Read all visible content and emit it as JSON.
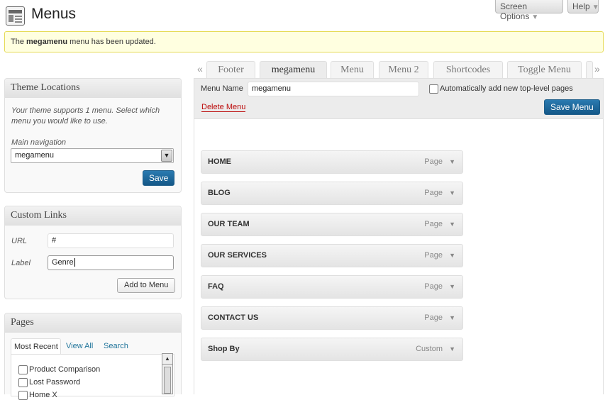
{
  "header": {
    "title": "Menus",
    "screen_options": "Screen Options",
    "help": "Help"
  },
  "notice": {
    "prefix": "The ",
    "menu_name": "megamenu",
    "suffix": " menu has been updated."
  },
  "theme_locations": {
    "title": "Theme Locations",
    "description": "Your theme supports 1 menu. Select which menu you would like to use.",
    "location_label": "Main navigation",
    "selected": "megamenu",
    "save_label": "Save"
  },
  "custom_links": {
    "title": "Custom Links",
    "url_label": "URL",
    "url_value": "#",
    "label_label": "Label",
    "label_value": "Genre",
    "add_label": "Add to Menu"
  },
  "pages": {
    "title": "Pages",
    "tabs": [
      "Most Recent",
      "View All",
      "Search"
    ],
    "items": [
      "Product Comparison",
      "Lost Password",
      "Home X"
    ]
  },
  "menu_tabs": [
    "Footer",
    "megamenu",
    "Menu",
    "Menu 2",
    "Shortcodes",
    "Toggle Menu"
  ],
  "menu_editor": {
    "name_label": "Menu Name",
    "name_value": "megamenu",
    "auto_add_label": "Automatically add new top-level pages",
    "delete_label": "Delete Menu",
    "save_label": "Save Menu"
  },
  "menu_items": [
    {
      "title": "HOME",
      "type": "Page"
    },
    {
      "title": "BLOG",
      "type": "Page"
    },
    {
      "title": "OUR TEAM",
      "type": "Page"
    },
    {
      "title": "OUR SERVICES",
      "type": "Page"
    },
    {
      "title": "FAQ",
      "type": "Page"
    },
    {
      "title": "CONTACT US",
      "type": "Page"
    },
    {
      "title": "Shop By",
      "type": "Custom"
    }
  ],
  "colors": {
    "accent": "#21759b",
    "notice_bg": "#ffffe0",
    "delete": "#bc0b0b"
  }
}
